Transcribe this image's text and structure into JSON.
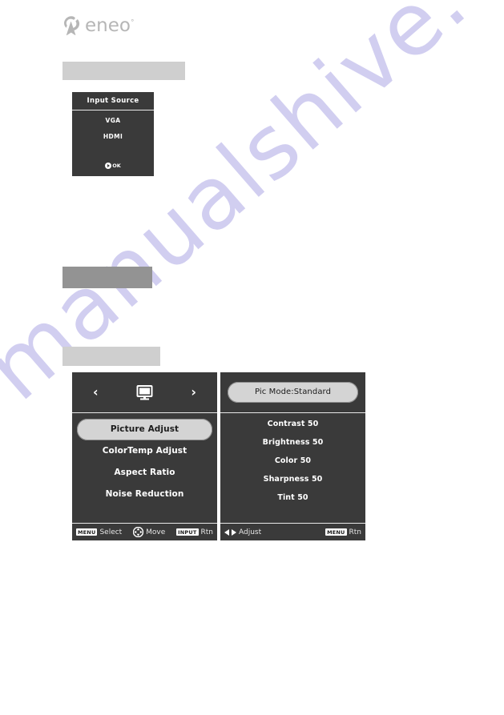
{
  "brand": {
    "name": "eneo",
    "trademark": "°",
    "logo_color": "#b6b6b6"
  },
  "watermark": {
    "text": "manualshive.com",
    "color": "#c9c6ee"
  },
  "placeholders": [
    {
      "name": "placeholder-bar-1",
      "color": "#cfcfcf"
    },
    {
      "name": "placeholder-bar-2",
      "color": "#939393"
    },
    {
      "name": "placeholder-bar-3",
      "color": "#cfcfcf"
    }
  ],
  "input_source_menu": {
    "title": "Input Source",
    "options": [
      "VGA",
      "HDMI"
    ],
    "footer": {
      "ok_icon": "ok-circle-icon",
      "ok_label": "OK"
    },
    "background": "#3a3a3a"
  },
  "osd_left": {
    "header": {
      "prev_icon": "chevron-left-icon",
      "prev_label": "‹",
      "category_icon": "monitor-icon",
      "next_icon": "chevron-right-icon",
      "next_label": "›"
    },
    "menu_items": [
      {
        "label": "Picture Adjust",
        "selected": true
      },
      {
        "label": "ColorTemp Adjust",
        "selected": false
      },
      {
        "label": "Aspect Ratio",
        "selected": false
      },
      {
        "label": "Noise Reduction",
        "selected": false
      }
    ],
    "footer": {
      "select_key": "MENU",
      "select_label": "Select",
      "move_icon": "dpad-icon",
      "move_label": "Move",
      "return_key": "INPUT",
      "return_label": "Rtn"
    }
  },
  "osd_right": {
    "header": {
      "pic_mode_label": "Pic Mode:Standard"
    },
    "settings": [
      {
        "label": "Contrast 50",
        "name": "Contrast",
        "value": 50
      },
      {
        "label": "Brightness 50",
        "name": "Brightness",
        "value": 50
      },
      {
        "label": "Color 50",
        "name": "Color",
        "value": 50
      },
      {
        "label": "Sharpness 50",
        "name": "Sharpness",
        "value": 50
      },
      {
        "label": "Tint 50",
        "name": "Tint",
        "value": 50
      }
    ],
    "footer": {
      "adjust_left_icon": "triangle-left-icon",
      "adjust_right_icon": "triangle-right-icon",
      "adjust_label": "Adjust",
      "return_key": "MENU",
      "return_label": "Rtn"
    }
  }
}
